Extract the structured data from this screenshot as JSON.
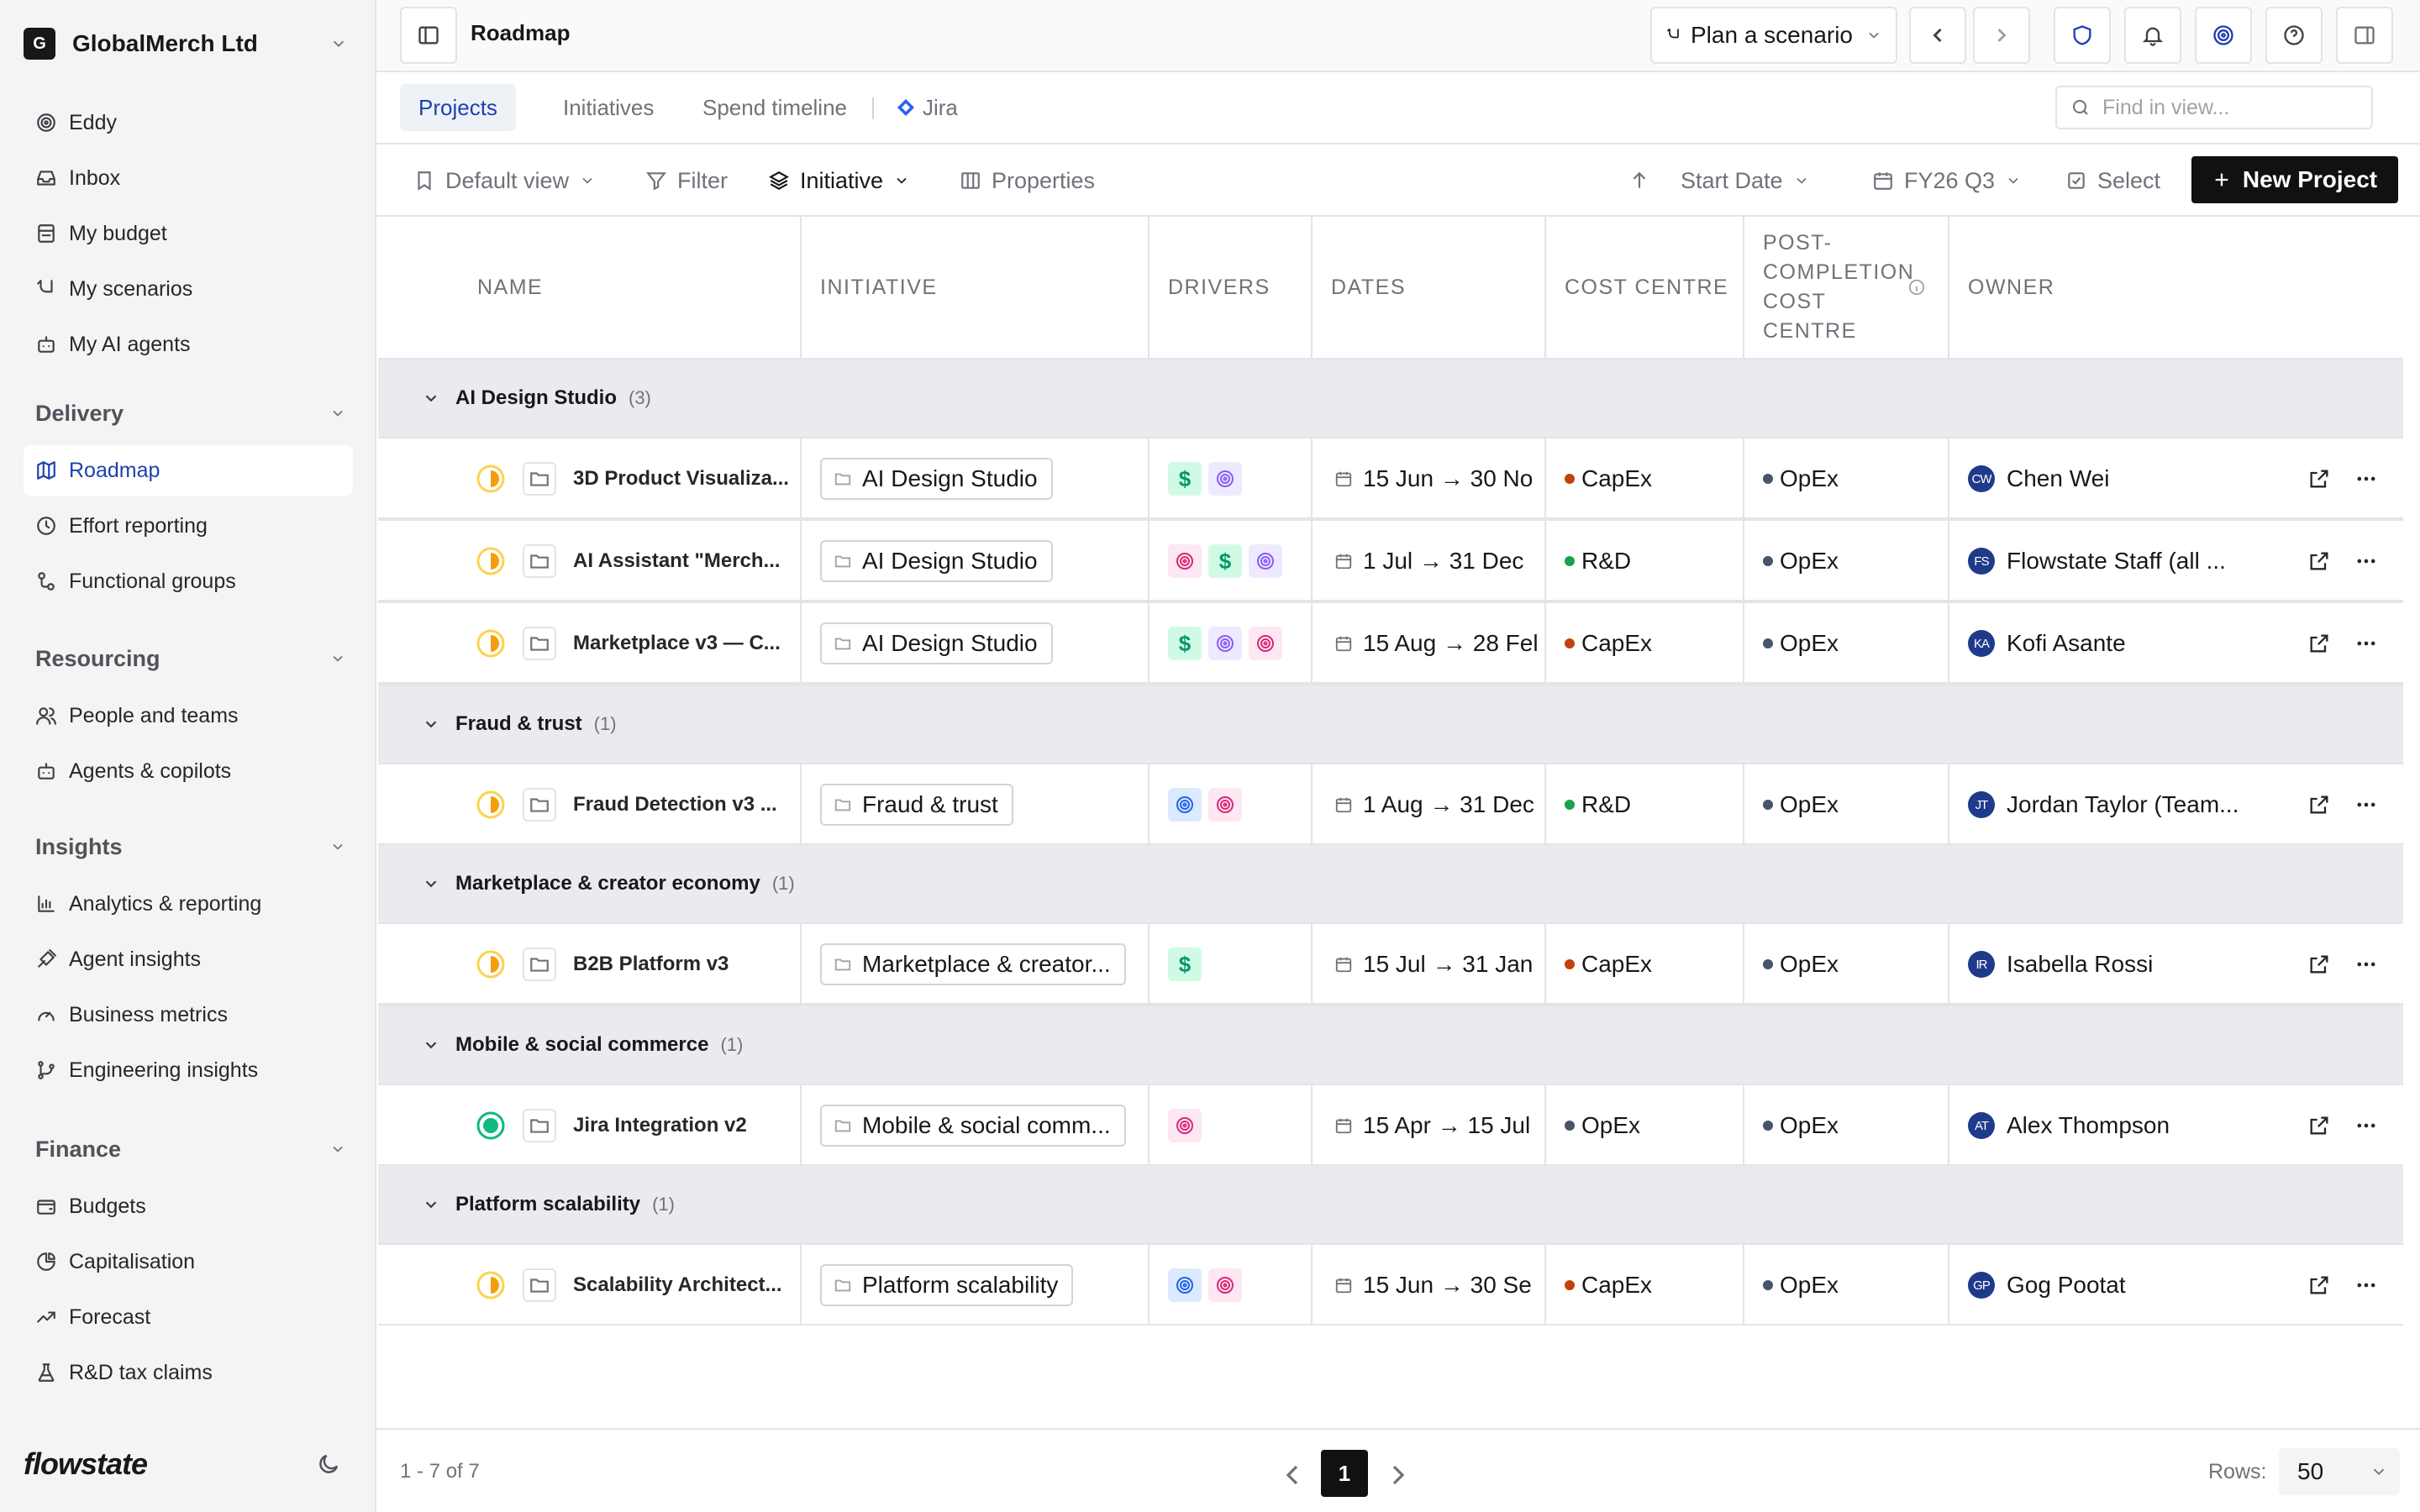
{
  "sidebar": {
    "org": {
      "initial": "G",
      "name": "GlobalMerch Ltd"
    },
    "top_items": [
      {
        "label": "Eddy",
        "icon": "eddy-icon"
      },
      {
        "label": "Inbox",
        "icon": "inbox-icon"
      },
      {
        "label": "My budget",
        "icon": "budget-icon"
      },
      {
        "label": "My scenarios",
        "icon": "scenarios-icon"
      },
      {
        "label": "My AI agents",
        "icon": "bot-icon"
      }
    ],
    "sections": [
      {
        "title": "Delivery",
        "items": [
          {
            "label": "Roadmap",
            "icon": "map-icon",
            "active": true
          },
          {
            "label": "Effort reporting",
            "icon": "clock-icon"
          },
          {
            "label": "Functional groups",
            "icon": "groups-icon"
          }
        ]
      },
      {
        "title": "Resourcing",
        "items": [
          {
            "label": "People and teams",
            "icon": "people-icon"
          },
          {
            "label": "Agents & copilots",
            "icon": "bot-icon"
          }
        ]
      },
      {
        "title": "Insights",
        "items": [
          {
            "label": "Analytics & reporting",
            "icon": "bar-chart-icon"
          },
          {
            "label": "Agent insights",
            "icon": "agent-insights-icon"
          },
          {
            "label": "Business metrics",
            "icon": "gauge-icon"
          },
          {
            "label": "Engineering insights",
            "icon": "git-icon"
          }
        ]
      },
      {
        "title": "Finance",
        "items": [
          {
            "label": "Budgets",
            "icon": "wallet-icon"
          },
          {
            "label": "Capitalisation",
            "icon": "pie-icon"
          },
          {
            "label": "Forecast",
            "icon": "trend-icon"
          },
          {
            "label": "R&D tax claims",
            "icon": "flask-icon"
          }
        ]
      }
    ],
    "brand": "flowstate"
  },
  "header": {
    "title": "Roadmap",
    "scenario_label": "Plan a scenario"
  },
  "tabs": [
    {
      "label": "Projects",
      "active": true
    },
    {
      "label": "Initiatives"
    },
    {
      "label": "Spend timeline"
    },
    {
      "label": "Jira"
    }
  ],
  "search": {
    "placeholder": "Find in view..."
  },
  "toolbar": {
    "view": "Default view",
    "filter": "Filter",
    "group_by": "Initiative",
    "properties": "Properties",
    "sort": "Start Date",
    "period": "FY26 Q3",
    "select": "Select",
    "new_project": "New Project"
  },
  "table": {
    "columns": {
      "name": "NAME",
      "initiative": "INITIATIVE",
      "drivers": "DRIVERS",
      "dates": "DATES",
      "cost_centre": "COST CENTRE",
      "post_completion": [
        "POST-",
        "COMPLETION",
        "COST",
        "CENTRE"
      ],
      "owner": "OWNER"
    },
    "groups": [
      {
        "name": "AI Design Studio",
        "count": "(3)",
        "rows": [
          {
            "name": "3D Product Visualiza...",
            "initiative": "AI Design Studio",
            "drivers": [
              "dollar",
              "target"
            ],
            "dates": "15 Jun → 30 No",
            "cost": "CapEx",
            "post": "OpEx",
            "owner_initials": "CW",
            "owner": "Chen Wei",
            "status": "half"
          },
          {
            "name": "AI Assistant \"Merch...",
            "initiative": "AI Design Studio",
            "drivers": [
              "pink",
              "dollar",
              "target"
            ],
            "dates": "1 Jul → 31 Dec",
            "cost": "R&D",
            "post": "OpEx",
            "owner_initials": "FS",
            "owner": "Flowstate Staff (all ...",
            "status": "half"
          },
          {
            "name": "Marketplace v3 — C...",
            "initiative": "AI Design Studio",
            "drivers": [
              "dollar",
              "target",
              "pink"
            ],
            "dates": "15 Aug → 28 Fel",
            "cost": "CapEx",
            "post": "OpEx",
            "owner_initials": "KA",
            "owner": "Kofi Asante",
            "status": "half"
          }
        ]
      },
      {
        "name": "Fraud & trust",
        "count": "(1)",
        "rows": [
          {
            "name": "Fraud Detection v3 ...",
            "initiative": "Fraud & trust",
            "drivers": [
              "blue",
              "pink"
            ],
            "dates": "1 Aug → 31 Dec",
            "cost": "R&D",
            "post": "OpEx",
            "owner_initials": "JT",
            "owner": "Jordan Taylor (Team...",
            "status": "half"
          }
        ]
      },
      {
        "name": "Marketplace & creator economy",
        "count": "(1)",
        "rows": [
          {
            "name": "B2B Platform v3",
            "initiative": "Marketplace & creator...",
            "drivers": [
              "dollar"
            ],
            "dates": "15 Jul → 31 Jan",
            "cost": "CapEx",
            "post": "OpEx",
            "owner_initials": "IR",
            "owner": "Isabella Rossi",
            "status": "half"
          }
        ]
      },
      {
        "name": "Mobile & social commerce",
        "count": "(1)",
        "rows": [
          {
            "name": "Jira Integration v2",
            "initiative": "Mobile & social comm...",
            "drivers": [
              "pink"
            ],
            "dates": "15 Apr → 15 Jul",
            "cost": "OpEx",
            "post": "OpEx",
            "owner_initials": "AT",
            "owner": "Alex Thompson",
            "status": "done"
          }
        ]
      },
      {
        "name": "Platform scalability",
        "count": "(1)",
        "rows": [
          {
            "name": "Scalability Architect...",
            "initiative": "Platform scalability",
            "drivers": [
              "blue",
              "pink"
            ],
            "dates": "15 Jun → 30 Se",
            "cost": "CapEx",
            "post": "OpEx",
            "owner_initials": "GP",
            "owner": "Gog Pootat",
            "status": "half"
          }
        ]
      }
    ]
  },
  "footer": {
    "range": "1 - 7 of 7",
    "page": "1",
    "rows_label": "Rows:",
    "rows_value": "50"
  },
  "colors": {
    "accent": "#1e40af",
    "capex": "#c2410c",
    "rnd": "#16a34a",
    "opex": "#475569",
    "status_half": "#f59e0b",
    "status_done": "#10b981"
  }
}
